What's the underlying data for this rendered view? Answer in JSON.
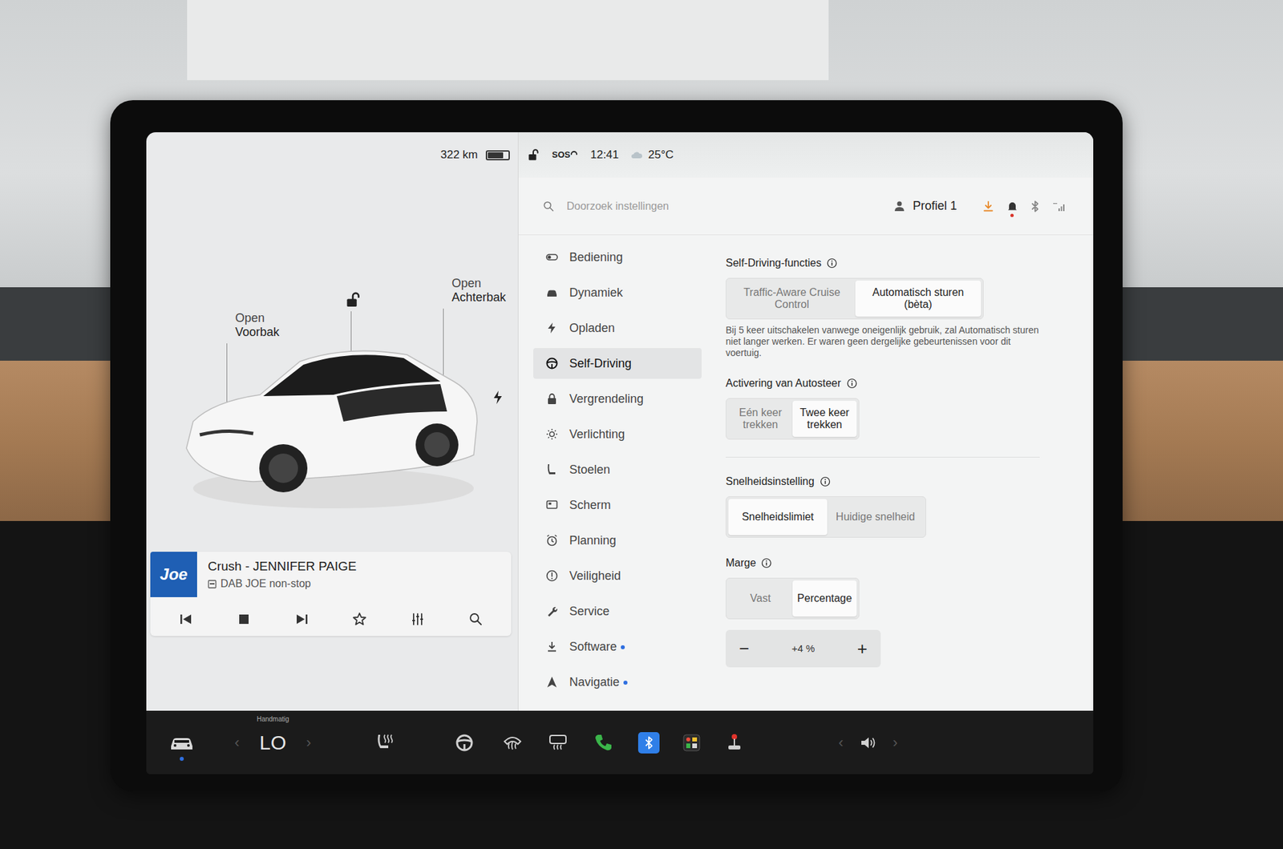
{
  "status_bar": {
    "range": "322 km",
    "battery_level": 0.75,
    "locked": false,
    "sos": "SOS",
    "time": "12:41",
    "temperature": "25°C"
  },
  "car": {
    "frunk_action": "Open",
    "frunk_label": "Voorbak",
    "trunk_action": "Open",
    "trunk_label": "Achterbak",
    "locked": false,
    "charge_port_visible": true
  },
  "media": {
    "logo": "Joe",
    "title": "Crush - JENNIFER PAIGE",
    "source": "DAB JOE non-stop"
  },
  "search": {
    "placeholder": "Doorzoek instellingen"
  },
  "header": {
    "profile": "Profiel 1",
    "download_pending": true,
    "bell_alert": true
  },
  "menu": [
    {
      "label": "Bediening",
      "selected": false,
      "dot": false
    },
    {
      "label": "Dynamiek",
      "selected": false,
      "dot": false
    },
    {
      "label": "Opladen",
      "selected": false,
      "dot": false
    },
    {
      "label": "Self-Driving",
      "selected": true,
      "dot": false
    },
    {
      "label": "Vergrendeling",
      "selected": false,
      "dot": false
    },
    {
      "label": "Verlichting",
      "selected": false,
      "dot": false
    },
    {
      "label": "Stoelen",
      "selected": false,
      "dot": false
    },
    {
      "label": "Scherm",
      "selected": false,
      "dot": false
    },
    {
      "label": "Planning",
      "selected": false,
      "dot": false
    },
    {
      "label": "Veiligheid",
      "selected": false,
      "dot": false
    },
    {
      "label": "Service",
      "selected": false,
      "dot": false
    },
    {
      "label": "Software",
      "selected": false,
      "dot": true
    },
    {
      "label": "Navigatie",
      "selected": false,
      "dot": true
    }
  ],
  "sections": [
    {
      "title": "Self-Driving-functies",
      "options": [
        {
          "label": "Traffic-Aware Cruise Control",
          "selected": false
        },
        {
          "label": "Automatisch sturen (bèta)",
          "selected": true
        }
      ],
      "note": "Bij 5 keer uitschakelen vanwege oneigenlijk gebruik, zal Automatisch sturen niet langer werken. Er waren geen dergelijke gebeurtenissen voor dit voertuig."
    },
    {
      "title": "Activering van Autosteer",
      "options": [
        {
          "label": "Eén keer trekken",
          "selected": false
        },
        {
          "label": "Twee keer trekken",
          "selected": true
        }
      ]
    },
    {
      "title": "Snelheidsinstelling",
      "options": [
        {
          "label": "Snelheidslimiet",
          "selected": true
        },
        {
          "label": "Huidige snelheid",
          "selected": false
        }
      ]
    },
    {
      "title": "Marge",
      "options": [
        {
          "label": "Vast",
          "selected": false
        },
        {
          "label": "Percentage",
          "selected": true
        }
      ],
      "stepper": {
        "minus": "−",
        "value": "+4 %",
        "plus": "+"
      }
    }
  ],
  "dock": {
    "car_active": true,
    "climate_mode": "Handmatig",
    "temperature": "LO",
    "temp_prev": "‹",
    "temp_next": "›",
    "volume_prev": "‹",
    "volume_next": "›"
  }
}
